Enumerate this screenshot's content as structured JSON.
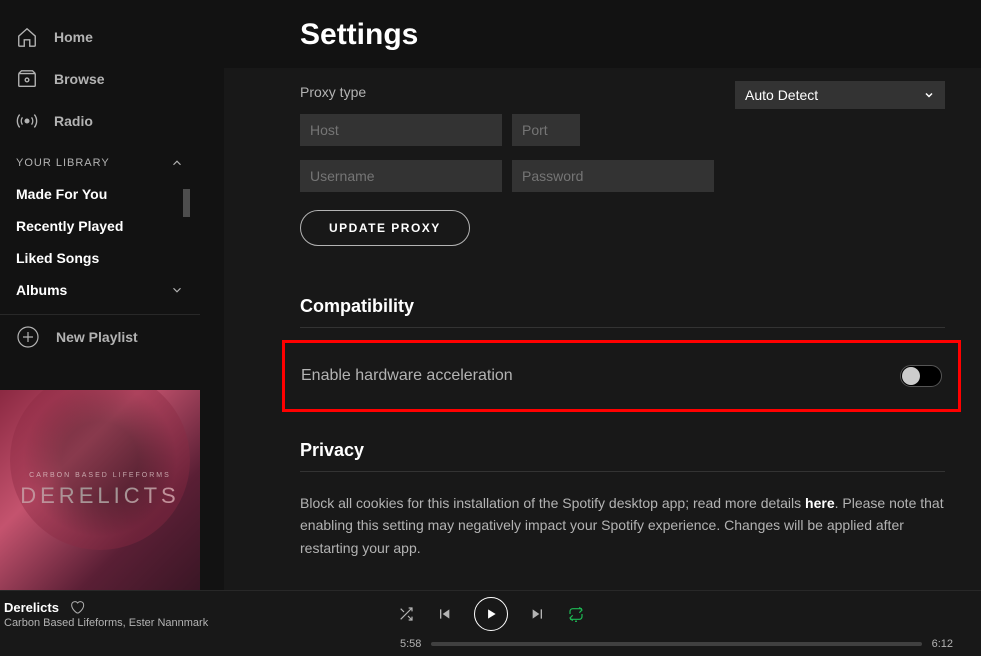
{
  "sidebar": {
    "nav": [
      {
        "label": "Home"
      },
      {
        "label": "Browse"
      },
      {
        "label": "Radio"
      }
    ],
    "library_header": "YOUR LIBRARY",
    "library": [
      {
        "label": "Made For You"
      },
      {
        "label": "Recently Played"
      },
      {
        "label": "Liked Songs"
      },
      {
        "label": "Albums"
      }
    ],
    "new_playlist": "New Playlist"
  },
  "album_art": {
    "subtitle": "CARBON BASED LIFEFORMS",
    "title": "DERELICTS"
  },
  "settings": {
    "page_title": "Settings",
    "proxy": {
      "type_label": "Proxy type",
      "type_value": "Auto Detect",
      "host": "Host",
      "port": "Port",
      "username": "Username",
      "password": "Password",
      "update_btn": "UPDATE PROXY"
    },
    "compatibility": {
      "heading": "Compatibility",
      "option": "Enable hardware acceleration"
    },
    "privacy": {
      "heading": "Privacy",
      "text_a": "Block all cookies for this installation of the Spotify desktop app; read more details ",
      "link": "here",
      "text_b": ". Please note that enabling this setting may negatively impact your Spotify experience. Changes will be applied after restarting your app."
    }
  },
  "player": {
    "track": "Derelicts",
    "artist": "Carbon Based Lifeforms, Ester Nannmark",
    "elapsed": "5:58",
    "total": "6:12"
  }
}
